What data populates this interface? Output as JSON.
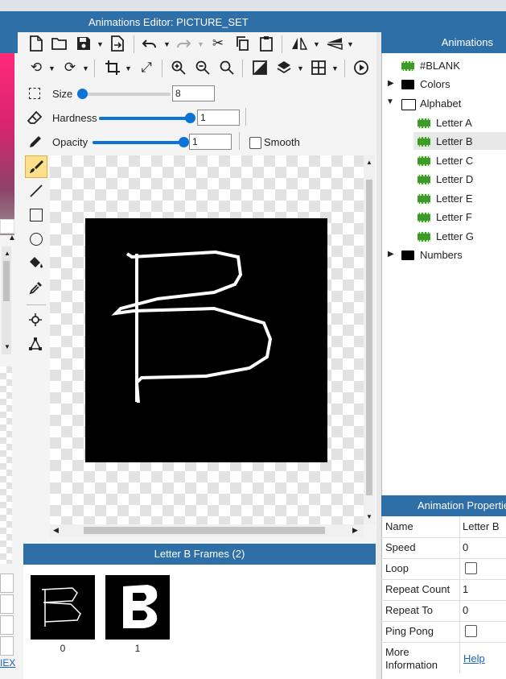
{
  "window": {
    "title": "Animations Editor: PICTURE_SET"
  },
  "left_panel": {
    "link_partial": "IEX"
  },
  "toolbar": {
    "row1": [
      "new-file-icon",
      "open-folder-icon",
      "save-icon",
      "export-icon",
      "undo-icon",
      "redo-icon",
      "cut-icon",
      "copy-icon",
      "paste-icon",
      "flip-horizontal-icon",
      "flip-vertical-icon"
    ],
    "row2": [
      "rotate-left-icon",
      "rotate-right-icon",
      "crop-icon",
      "resize-icon",
      "zoom-in-icon",
      "zoom-out-icon",
      "zoom-fit-icon",
      "invert-icon",
      "layers-icon",
      "grid-icon",
      "play-icon"
    ]
  },
  "brush": {
    "size_label": "Size",
    "size_value": "8",
    "size_fraction": 0.05,
    "hardness_label": "Hardness",
    "hardness_value": "1",
    "hardness_fraction": 1.0,
    "opacity_label": "Opacity",
    "opacity_value": "1",
    "opacity_fraction": 1.0,
    "smooth_label": "Smooth"
  },
  "tools": [
    "brush-tool",
    "line-tool",
    "rectangle-tool",
    "ellipse-tool",
    "fill-tool",
    "eyedropper-tool",
    "target-tool",
    "polygon-tool"
  ],
  "frames": {
    "header": "Letter B Frames (2)",
    "items": [
      {
        "label": "0"
      },
      {
        "label": "1"
      }
    ]
  },
  "animations": {
    "header": "Animations",
    "tree": {
      "blank": "#BLANK",
      "colors": "Colors",
      "alphabet": "Alphabet",
      "letters": [
        "Letter A",
        "Letter B",
        "Letter C",
        "Letter D",
        "Letter E",
        "Letter F",
        "Letter G"
      ],
      "numbers": "Numbers"
    }
  },
  "properties": {
    "header": "Animation Properties",
    "rows": [
      {
        "key": "Name",
        "value": "Letter B"
      },
      {
        "key": "Speed",
        "value": "0"
      },
      {
        "key": "Loop",
        "value": ""
      },
      {
        "key": "Repeat Count",
        "value": "1"
      },
      {
        "key": "Repeat To",
        "value": "0"
      },
      {
        "key": "Ping Pong",
        "value": ""
      }
    ],
    "more_info_key": "More Information",
    "help_link": "Help"
  }
}
